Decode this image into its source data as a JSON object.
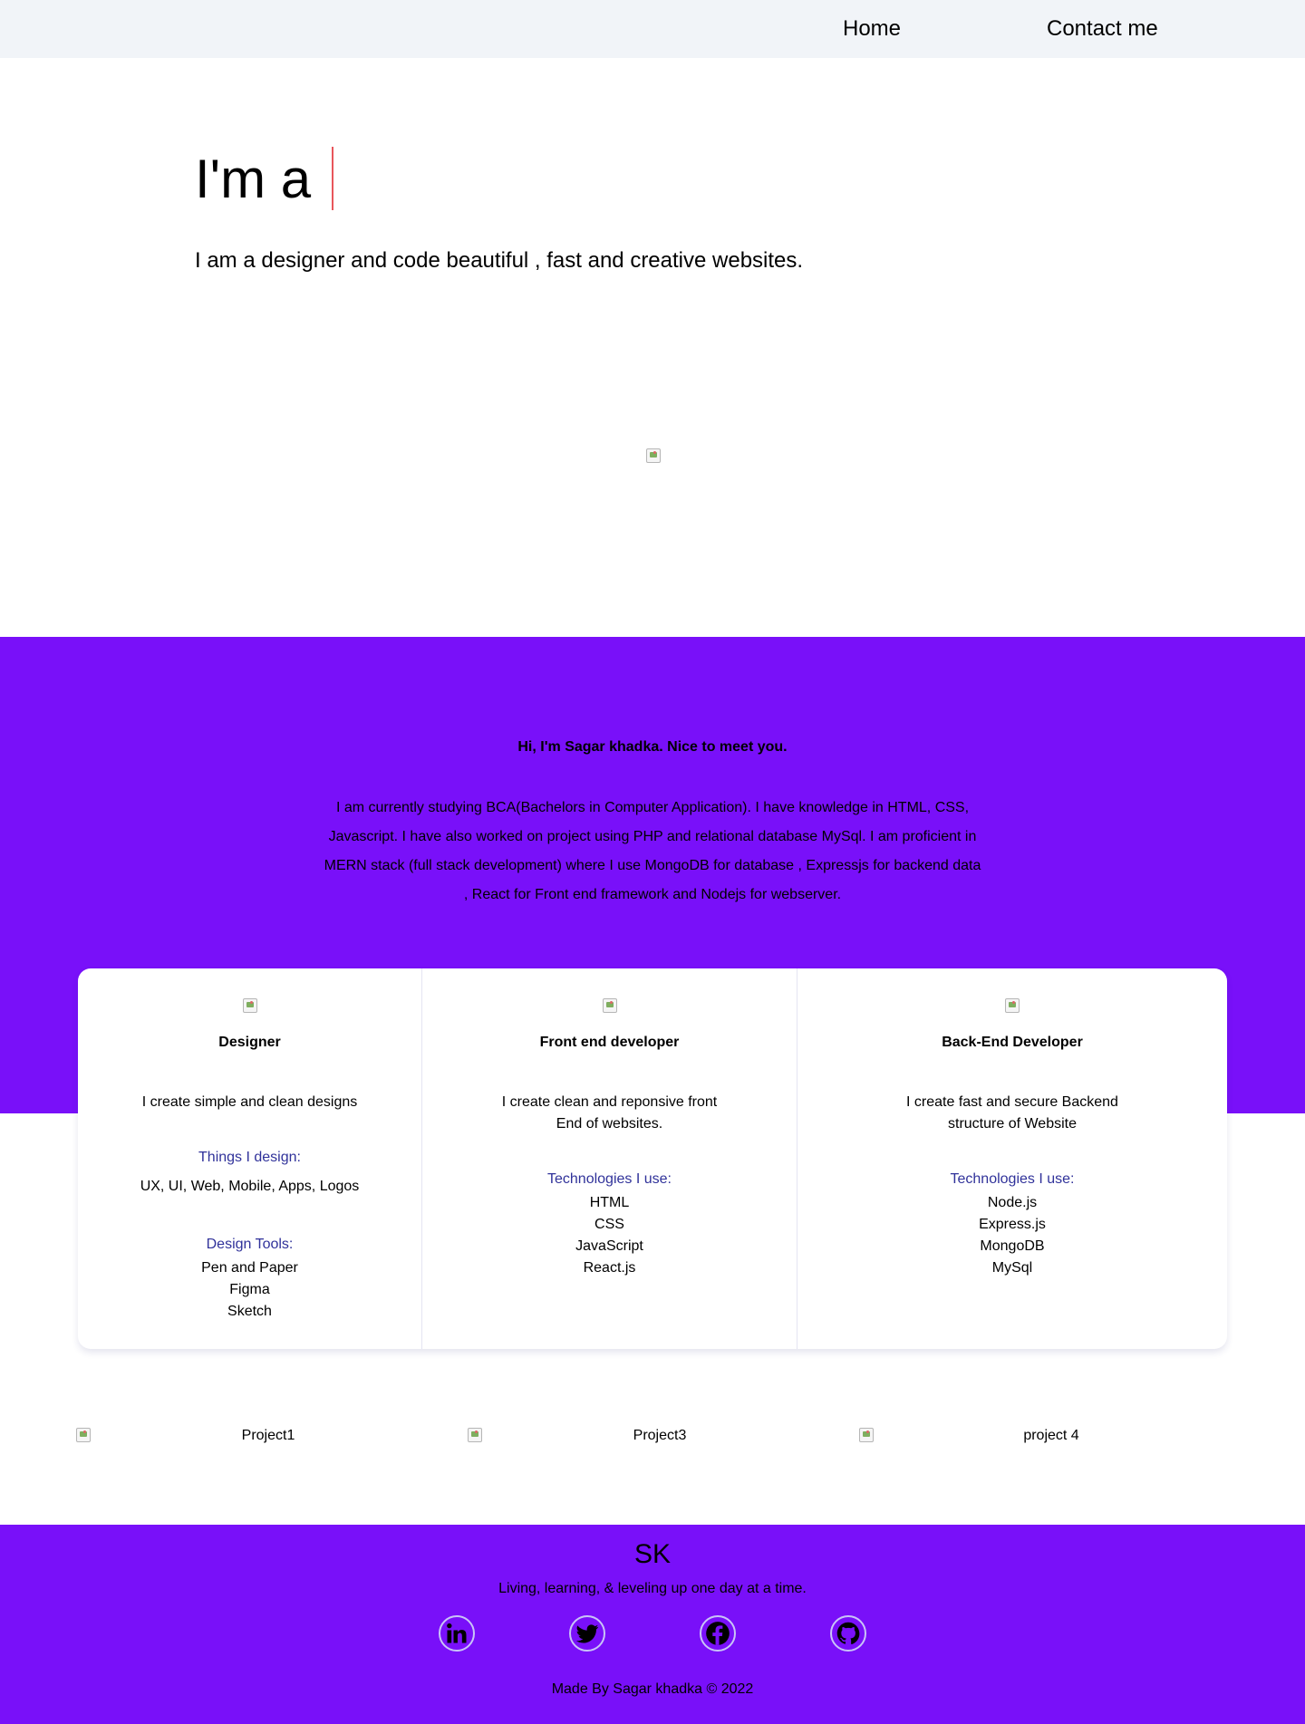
{
  "nav": {
    "home": "Home",
    "contact": "Contact me"
  },
  "hero": {
    "title": "I'm a",
    "subtitle": "I am a designer and code beautiful , fast and creative websites."
  },
  "about": {
    "greeting": "Hi, I'm Sagar khadka. Nice to meet you.",
    "text": "I am currently studying BCA(Bachelors in Computer Application). I have knowledge in HTML, CSS, Javascript. I have also worked on project using PHP and relational database MySql. I am proficient in MERN stack (full stack development) where I use MongoDB for database , Expressjs for backend data , React for Front end framework and Nodejs for webserver."
  },
  "skills": {
    "designer": {
      "title": "Designer",
      "description": "I create simple and clean designs",
      "things_heading": "Things I design:",
      "things": "UX, UI, Web, Mobile, Apps, Logos",
      "tools_heading": "Design Tools:",
      "tools": [
        "Pen and Paper",
        "Figma",
        "Sketch"
      ]
    },
    "frontend": {
      "title": "Front end developer",
      "description": "I create clean and reponsive front End of websites.",
      "tech_heading": "Technologies I use:",
      "tech": [
        "HTML",
        "CSS",
        "JavaScript",
        "React.js"
      ]
    },
    "backend": {
      "title": "Back-End Developer",
      "description": "I create fast and secure Backend structure of Website",
      "tech_heading": "Technologies I use:",
      "tech": [
        "Node.js",
        "Express.js",
        "MongoDB",
        "MySql"
      ]
    }
  },
  "projects": [
    "Project1",
    "Project3",
    "project 4"
  ],
  "footer": {
    "logo": "SK",
    "tagline": "Living, learning, & leveling up one day at a time.",
    "social": [
      "linkedin-icon",
      "twitter-icon",
      "facebook-icon",
      "github-icon"
    ],
    "copyright": "Made By Sagar khadka ©   2022"
  },
  "colors": {
    "purple": "#7910f9",
    "nav_bg": "#f1f4f8",
    "caret": "#e8565b",
    "heading_blue": "#30329a"
  }
}
